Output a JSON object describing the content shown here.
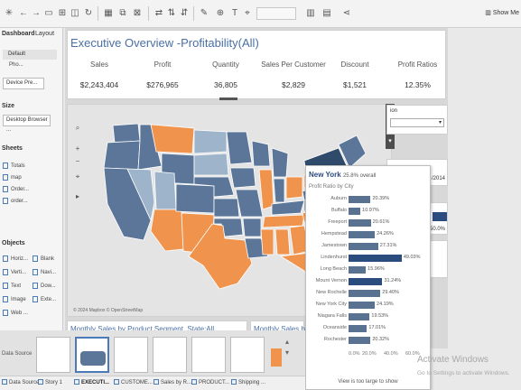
{
  "toolbar": {
    "show_me": "Show Me"
  },
  "left_pane": {
    "tab_dashboard": "Dashboard",
    "tab_layout": "Layout",
    "device_default": "Default",
    "device_phone": "Pho...",
    "device_preview": "Device Pre...",
    "size_label": "Size",
    "size_value": "Desktop Browser ...",
    "sheets_label": "Sheets",
    "sheets": [
      "Totals",
      "map",
      "Order...",
      "order..."
    ],
    "objects_label": "Objects",
    "objects": [
      "Horiz...",
      "Blank",
      "Verti...",
      "Navi...",
      "Text",
      "Dow...",
      "Image",
      "Exte...",
      "Web ..."
    ]
  },
  "dashboard": {
    "title": "Executive Overview -Profitability(All)",
    "kpis": [
      {
        "label": "Sales",
        "value": "$2,243,404"
      },
      {
        "label": "Profit",
        "value": "$276,965"
      },
      {
        "label": "Quantity",
        "value": "36,805"
      },
      {
        "label": "Sales Per Customer",
        "value": "$2,829"
      },
      {
        "label": "Discount",
        "value": "$1,521"
      },
      {
        "label": "Profit Ratios",
        "value": "12.35%"
      }
    ],
    "map_attribution": "© 2024 Mapbox © OpenStreetMap",
    "bottom_left_title": "Monthly Sales by Product Segment, State:All",
    "bottom_right_title": "Monthly Sales b",
    "right_pane_label": "ion",
    "right_pane_date": "/2014",
    "right_pane_value": "50.0%"
  },
  "tooltip": {
    "title": "New York",
    "title_suffix": "25.8% overall",
    "subtitle": "Profit Ratio by City",
    "axis_ticks": [
      "0.0%",
      "20.0%",
      "40.0%",
      "60.0%"
    ],
    "footer": "View is too large to show",
    "chart_data": {
      "type": "bar",
      "title": "Profit Ratio by City",
      "categories": [
        "Auburn",
        "Buffalo",
        "Freeport",
        "Hempstead",
        "Jamestown",
        "Lindenhurst",
        "Long Beach",
        "Mount Vernon",
        "New Rochelle",
        "New York City",
        "Niagara Falls",
        "Oceanside",
        "Rochester"
      ],
      "values": [
        20.39,
        10.97,
        20.61,
        24.26,
        27.31,
        49.03,
        15.96,
        31.24,
        29.4,
        24.19,
        19.53,
        17.01,
        20.32
      ],
      "labels": [
        "20.39%",
        "10.97%",
        "20.61%",
        "24.26%",
        "27.31%",
        "49.03%",
        "15.96%",
        "31.24%",
        "29.40%",
        "24.19%",
        "19.53%",
        "17.01%",
        "20.32%"
      ],
      "highlight": [
        "Lindenhurst",
        "Mount Vernon"
      ],
      "xlim": [
        0,
        60
      ],
      "bar_color": "#5a7292",
      "highlight_color": "#2b4c7e"
    }
  },
  "bottom": {
    "data_source": "Data Source",
    "tabs": [
      "Data Source",
      "Story 1",
      "EXECUTI...",
      "CUSTOME...",
      "Sales by R...",
      "PRODUCT...",
      "Shipping ..."
    ]
  },
  "watermark": {
    "line1": "Activate Windows",
    "line2": "Go to Settings to activate Windows."
  },
  "colors": {
    "accent": "#4a6fa5",
    "map_blue": "#5b7699",
    "map_orange": "#f0944d",
    "map_light": "#9eb4ca"
  }
}
